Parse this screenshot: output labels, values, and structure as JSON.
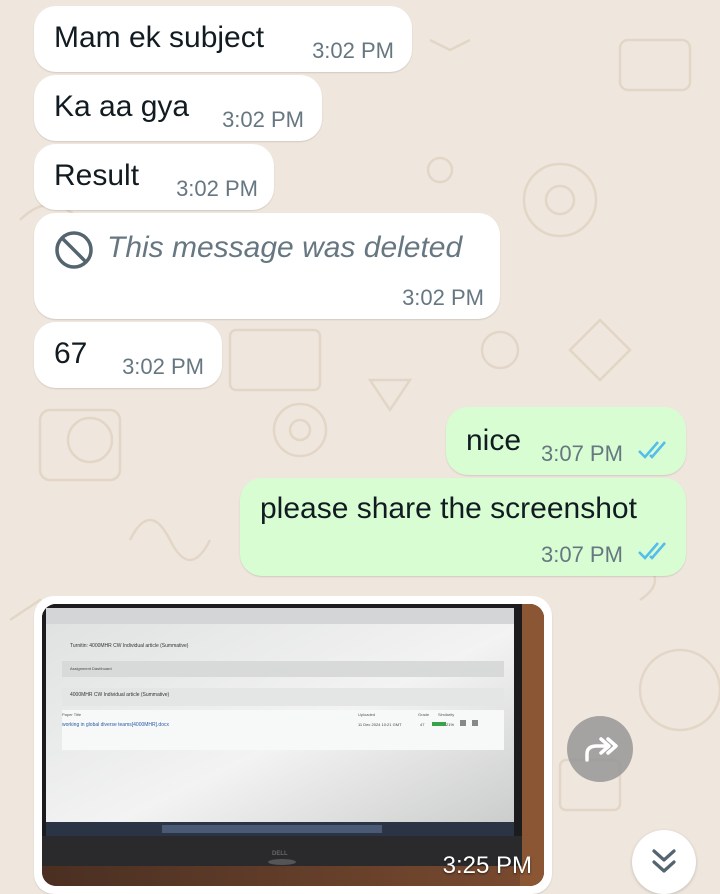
{
  "messages": [
    {
      "id": "m1",
      "direction": "incoming",
      "text": "Mam ek subject",
      "time": "3:02 PM"
    },
    {
      "id": "m2",
      "direction": "incoming",
      "text": "Ka aa gya",
      "time": "3:02 PM"
    },
    {
      "id": "m3",
      "direction": "incoming",
      "text": "Result",
      "time": "3:02 PM"
    },
    {
      "id": "m4",
      "direction": "incoming",
      "deleted": true,
      "text": "This message was deleted",
      "time": "3:02 PM"
    },
    {
      "id": "m5",
      "direction": "incoming",
      "text": "67",
      "time": "3:02 PM"
    },
    {
      "id": "m6",
      "direction": "outgoing",
      "text": "nice",
      "time": "3:07 PM",
      "status": "read"
    },
    {
      "id": "m7",
      "direction": "outgoing",
      "text": "please share the screenshot",
      "time": "3:07 PM",
      "status": "read"
    },
    {
      "id": "m8",
      "direction": "incoming",
      "type": "image",
      "time": "3:25 PM"
    }
  ],
  "photo": {
    "description_icon": "laptop-photo",
    "turnitin_title": "Turnitin: 4000MHR CW Individual article (Summative)",
    "nav_label": "Assignment Dashboard",
    "breadcrumb": "4000MHR CW Individual article (Summative)",
    "col_paper_title": "Paper Title",
    "col_uploaded": "Uploaded",
    "col_grade": "Grade",
    "col_similarity": "Similarity",
    "row_paper": "working in global diverse teams[4000MHR].docx",
    "row_uploaded": "11 Dec 2024 10:21 GMT",
    "row_grade": "47",
    "row_similarity": "21%",
    "brand": "DELL"
  },
  "icons": {
    "forward": "forward-icon",
    "scroll_down": "double-chevron-down-icon",
    "deleted": "prohibited-icon",
    "read_ticks": "double-check-icon"
  },
  "colors": {
    "wallpaper": "#efe7dd",
    "incoming_bubble": "#ffffff",
    "outgoing_bubble": "#d9fdd3",
    "read_tick": "#53bdeb",
    "timestamp": "#667781"
  }
}
